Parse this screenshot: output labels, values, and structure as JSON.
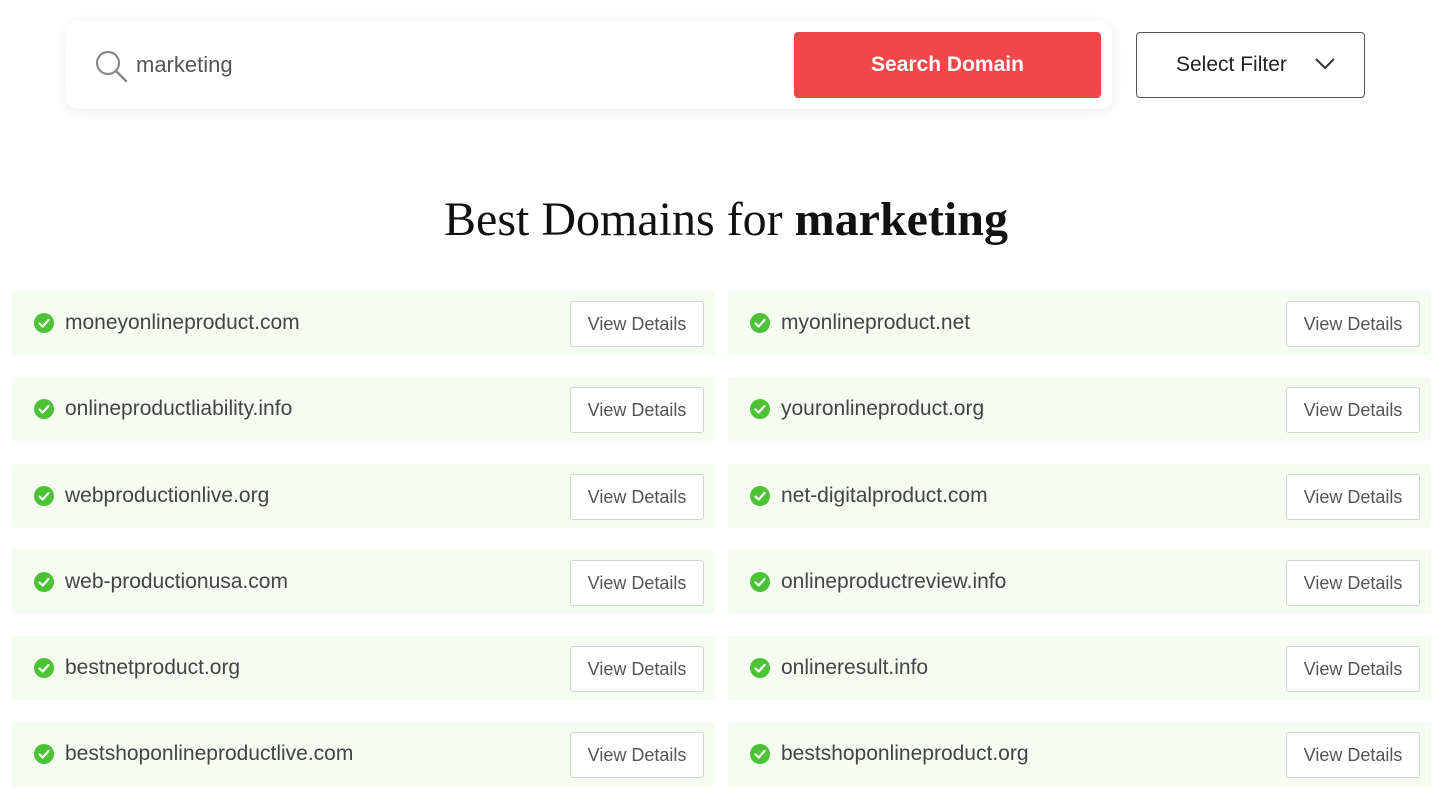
{
  "search": {
    "value": "marketing",
    "button_label": "Search Domain",
    "filter_label": "Select Filter"
  },
  "heading": {
    "prefix": "Best Domains for ",
    "keyword": "marketing"
  },
  "results": {
    "button_label": "View Details",
    "left": [
      "moneyonlineproduct.com",
      "onlineproductliability.info",
      "webproductionlive.org",
      "web-productionusa.com",
      "bestnetproduct.org",
      "bestshoponlineproductlive.com"
    ],
    "right": [
      "myonlineproduct.net",
      "youronlineproduct.org",
      "net-digitalproduct.com",
      "onlineproductreview.info",
      "onlineresult.info",
      "bestshoponlineproduct.org"
    ]
  },
  "colors": {
    "accent": "#f04848",
    "available": "#4cc235",
    "row_background": "#f5fdf0"
  },
  "icons": {
    "search": "search-icon",
    "filter": "chevron-down-icon",
    "available": "check-circle-icon"
  }
}
